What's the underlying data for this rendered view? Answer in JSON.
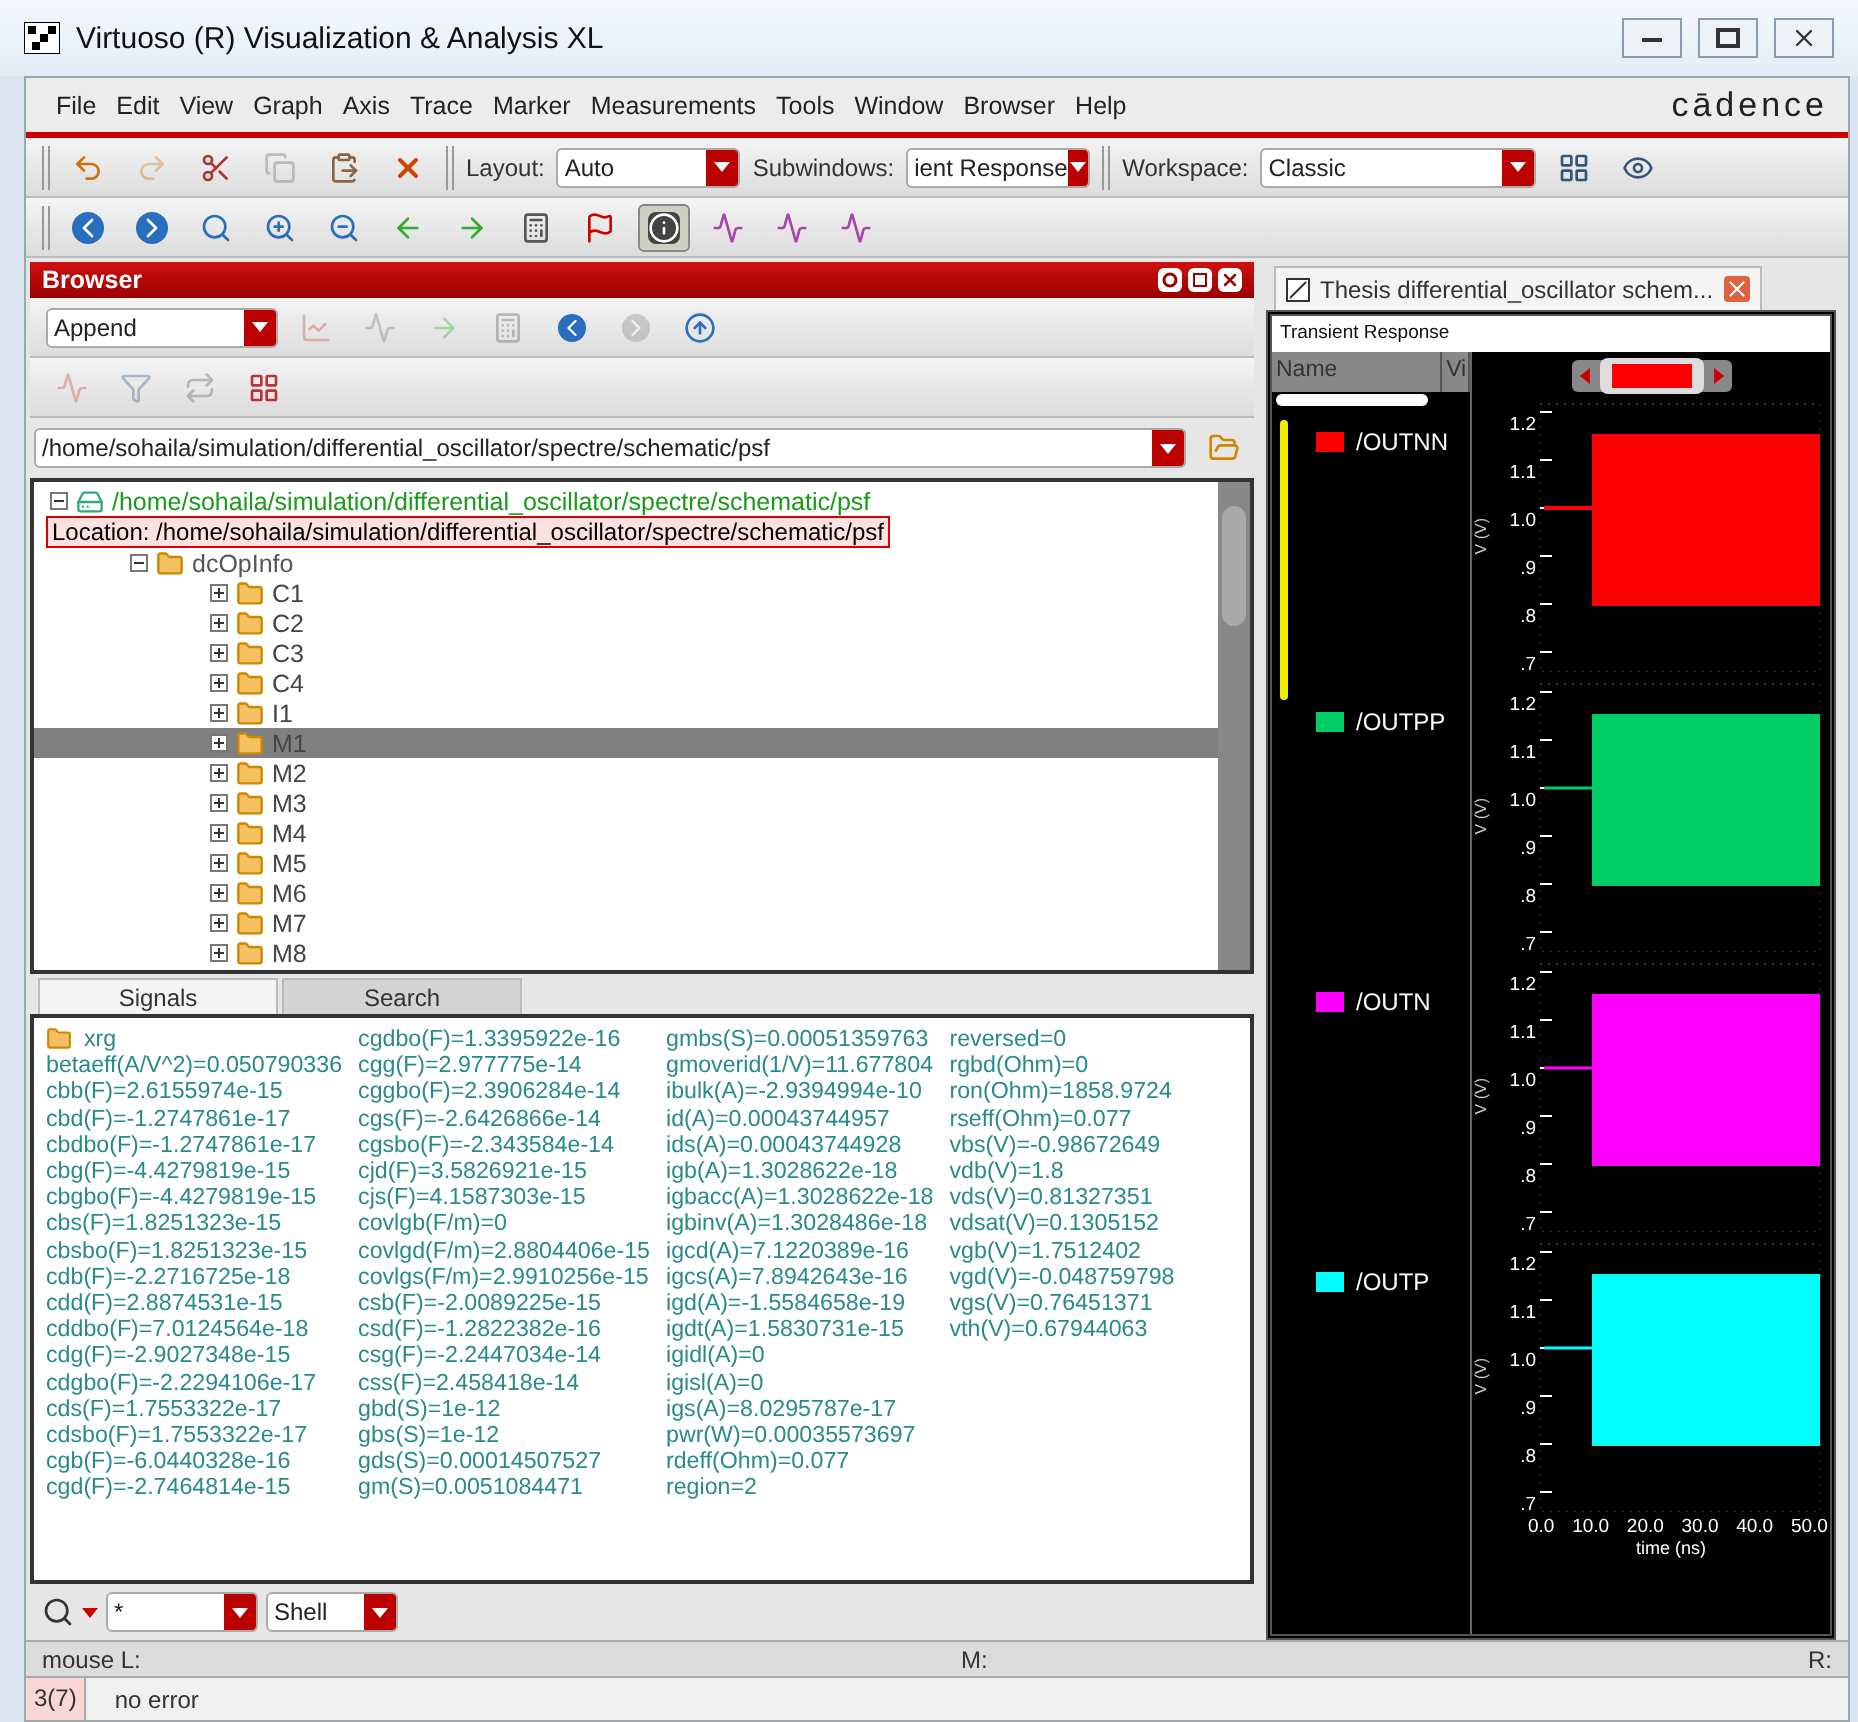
{
  "window": {
    "title": "Virtuoso (R) Visualization & Analysis XL"
  },
  "menu": [
    "File",
    "Edit",
    "View",
    "Graph",
    "Axis",
    "Trace",
    "Marker",
    "Measurements",
    "Tools",
    "Window",
    "Browser",
    "Help"
  ],
  "brand": "cādence",
  "toolbar_1": [
    {
      "kind": "undo",
      "disabled": false
    },
    {
      "kind": "redo",
      "disabled": true
    },
    {
      "kind": "cut",
      "disabled": false
    },
    {
      "kind": "copy",
      "disabled": true
    },
    {
      "kind": "paste",
      "disabled": false
    },
    {
      "kind": "delete",
      "disabled": false
    }
  ],
  "layout": {
    "label": "Layout:",
    "value": "Auto"
  },
  "subwindows": {
    "label": "Subwindows:",
    "value": "ient Response"
  },
  "workspace": {
    "label": "Workspace:",
    "value": "Classic"
  },
  "toolbar_2": [
    {
      "kind": "back",
      "pressed": false
    },
    {
      "kind": "forward",
      "pressed": false
    },
    {
      "kind": "zoom",
      "pressed": false
    },
    {
      "kind": "zoom-in",
      "pressed": false
    },
    {
      "kind": "zoom-out",
      "pressed": false
    },
    {
      "kind": "left",
      "pressed": false
    },
    {
      "kind": "right",
      "pressed": false
    },
    {
      "kind": "calc",
      "pressed": false
    },
    {
      "kind": "flag",
      "pressed": false
    },
    {
      "kind": "info",
      "pressed": true
    },
    {
      "kind": "wave",
      "pressed": false
    },
    {
      "kind": "wave",
      "pressed": false
    },
    {
      "kind": "wave",
      "pressed": false
    }
  ],
  "browser": {
    "title": "Browser",
    "mode": "Append",
    "path": "/home/sohaila/simulation/differential_oscillator/spectre/schematic/psf",
    "tree": {
      "label": "/home/sohaila/simulation/differential_oscillator/spectre/schematic/psf",
      "expanded": true,
      "tooltip": "Location: /home/sohaila/simulation/differential_oscillator/spectre/schematic/psf",
      "children": [
        {
          "label": "dcOpInfo",
          "expanded": true,
          "children": [
            {
              "label": "C1",
              "selected": false
            },
            {
              "label": "C2",
              "selected": false
            },
            {
              "label": "C3",
              "selected": false
            },
            {
              "label": "C4",
              "selected": false
            },
            {
              "label": "I1",
              "selected": false
            },
            {
              "label": "M1",
              "selected": true
            },
            {
              "label": "M2",
              "selected": false
            },
            {
              "label": "M3",
              "selected": false
            },
            {
              "label": "M4",
              "selected": false
            },
            {
              "label": "M5",
              "selected": false
            },
            {
              "label": "M6",
              "selected": false
            },
            {
              "label": "M7",
              "selected": false
            },
            {
              "label": "M8",
              "selected": false
            }
          ]
        }
      ]
    },
    "tabs": [
      {
        "label": "Signals",
        "selected": true
      },
      {
        "label": "Search",
        "selected": false
      }
    ],
    "folder": "xrg",
    "columns": [
      [
        "betaeff(A/V^2)=0.050790336",
        "cbb(F)=2.6155974e-15",
        "cbd(F)=-1.2747861e-17",
        "cbdbo(F)=-1.2747861e-17",
        "cbg(F)=-4.4279819e-15",
        "cbgbo(F)=-4.4279819e-15",
        "cbs(F)=1.8251323e-15",
        "cbsbo(F)=1.8251323e-15",
        "cdb(F)=-2.2716725e-18",
        "cdd(F)=2.8874531e-15",
        "cddbo(F)=7.0124564e-18",
        "cdg(F)=-2.9027348e-15",
        "cdgbo(F)=-2.2294106e-17",
        "cds(F)=1.7553322e-17",
        "cdsbo(F)=1.7553322e-17",
        "cgb(F)=-6.0440328e-16",
        "cgd(F)=-2.7464814e-15"
      ],
      [
        "cgdbo(F)=1.3395922e-16",
        "cgg(F)=2.977775e-14",
        "cggbo(F)=2.3906284e-14",
        "cgs(F)=-2.6426866e-14",
        "cgsbo(F)=-2.343584e-14",
        "cjd(F)=3.5826921e-15",
        "cjs(F)=4.1587303e-15",
        "covlgb(F/m)=0",
        "covlgd(F/m)=2.8804406e-15",
        "covlgs(F/m)=2.9910256e-15",
        "csb(F)=-2.0089225e-15",
        "csd(F)=-1.2822382e-16",
        "csg(F)=-2.2447034e-14",
        "css(F)=2.458418e-14",
        "gbd(S)=1e-12",
        "gbs(S)=1e-12",
        "gds(S)=0.00014507527",
        "gm(S)=0.0051084471"
      ],
      [
        "gmbs(S)=0.00051359763",
        "gmoverid(1/V)=11.677804",
        "ibulk(A)=-2.9394994e-10",
        "id(A)=0.00043744957",
        "ids(A)=0.00043744928",
        "igb(A)=1.3028622e-18",
        "igbacc(A)=1.3028622e-18",
        "igbinv(A)=1.3028486e-18",
        "igcd(A)=7.1220389e-16",
        "igcs(A)=7.8942643e-16",
        "igd(A)=-1.5584658e-19",
        "igdt(A)=1.5830731e-15",
        "igidl(A)=0",
        "igisl(A)=0",
        "igs(A)=8.0295787e-17",
        "pwr(W)=0.00035573697",
        "rdeff(Ohm)=0.077",
        "region=2"
      ],
      [
        "reversed=0",
        "rgbd(Ohm)=0",
        "ron(Ohm)=1858.9724",
        "rseff(Ohm)=0.077",
        "vbs(V)=-0.98672649",
        "vdb(V)=1.8",
        "vds(V)=0.81327351",
        "vdsat(V)=0.1305152",
        "vgb(V)=1.7512402",
        "vgd(V)=-0.048759798",
        "vgs(V)=0.76451371",
        "vth(V)=0.67944063"
      ]
    ],
    "filter": "*",
    "shell": "Shell"
  },
  "graph": {
    "tab": "Thesis differential_oscillator schem...",
    "title": "Transient Response",
    "name_header": "Name",
    "value_header": "Vi",
    "traces": [
      {
        "name": "/OUTNN",
        "color": "#ff0000",
        "selected": true,
        "y_ticks": [
          "1.2",
          "1.1",
          "1.0",
          ".9",
          ".8",
          ".7"
        ],
        "y_label": "V (V)"
      },
      {
        "name": "/OUTPP",
        "color": "#00cc66",
        "selected": false,
        "y_ticks": [
          "1.2",
          "1.1",
          "1.0",
          ".9",
          ".8",
          ".7"
        ],
        "y_label": "V (V)"
      },
      {
        "name": "/OUTN",
        "color": "#ff00ff",
        "selected": false,
        "y_ticks": [
          "1.2",
          "1.1",
          "1.0",
          ".9",
          ".8",
          ".7"
        ],
        "y_label": "V (V)"
      },
      {
        "name": "/OUTP",
        "color": "#00ffff",
        "selected": false,
        "y_ticks": [
          "1.2",
          "1.1",
          "1.0",
          ".9",
          ".8",
          ".7"
        ],
        "y_label": "V (V)"
      }
    ],
    "x_ticks": [
      "0.0",
      "10.0",
      "20.0",
      "30.0",
      "40.0",
      "50.0"
    ],
    "x_label": "time (ns)"
  },
  "status": {
    "left": "mouse L:",
    "middle": "M:",
    "right": "R:",
    "count": "3(7)",
    "message": "no error"
  }
}
